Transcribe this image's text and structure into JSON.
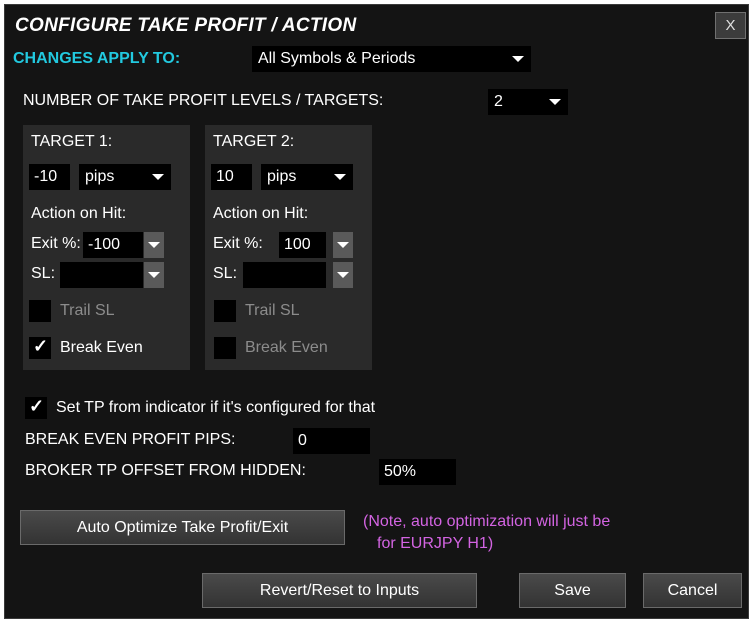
{
  "title": "CONFIGURE TAKE PROFIT / ACTION",
  "close_label": "X",
  "changes_apply_to": {
    "label": "CHANGES APPLY TO:",
    "value": "All Symbols & Periods"
  },
  "levels": {
    "label": "NUMBER OF TAKE PROFIT LEVELS / TARGETS:",
    "value": "2"
  },
  "targets": [
    {
      "label": "TARGET 1:",
      "value": "-10",
      "unit": "pips",
      "action_label": "Action on Hit:",
      "exit_label": "Exit %:",
      "exit_value": "-100",
      "sl_label": "SL:",
      "sl_value": "",
      "trail_label": "Trail SL",
      "trail_checked": false,
      "break_even_label": "Break Even",
      "break_even_checked": true
    },
    {
      "label": "TARGET 2:",
      "value": "10",
      "unit": "pips",
      "action_label": "Action on Hit:",
      "exit_label": "Exit %:",
      "exit_value": "100",
      "sl_label": "SL:",
      "sl_value": "",
      "trail_label": "Trail SL",
      "trail_checked": false,
      "break_even_label": "Break Even",
      "break_even_checked": false
    }
  ],
  "set_tp": {
    "label": "Set TP from indicator if it's configured for that",
    "checked": true
  },
  "break_even_profit": {
    "label": "BREAK EVEN PROFIT PIPS:",
    "value": "0"
  },
  "broker_offset": {
    "label": "BROKER TP OFFSET FROM HIDDEN:",
    "value": "50%"
  },
  "auto_optimize_label": "Auto Optimize Take Profit/Exit",
  "note_line1": "(Note, auto optimization will just be",
  "note_line2": "for EURJPY H1)",
  "buttons": {
    "revert": "Revert/Reset to Inputs",
    "save": "Save",
    "cancel": "Cancel"
  },
  "colors": {
    "accent": "#22c9df",
    "note": "#d364e2",
    "background": "#141414",
    "panel": "#2a2a2a"
  }
}
